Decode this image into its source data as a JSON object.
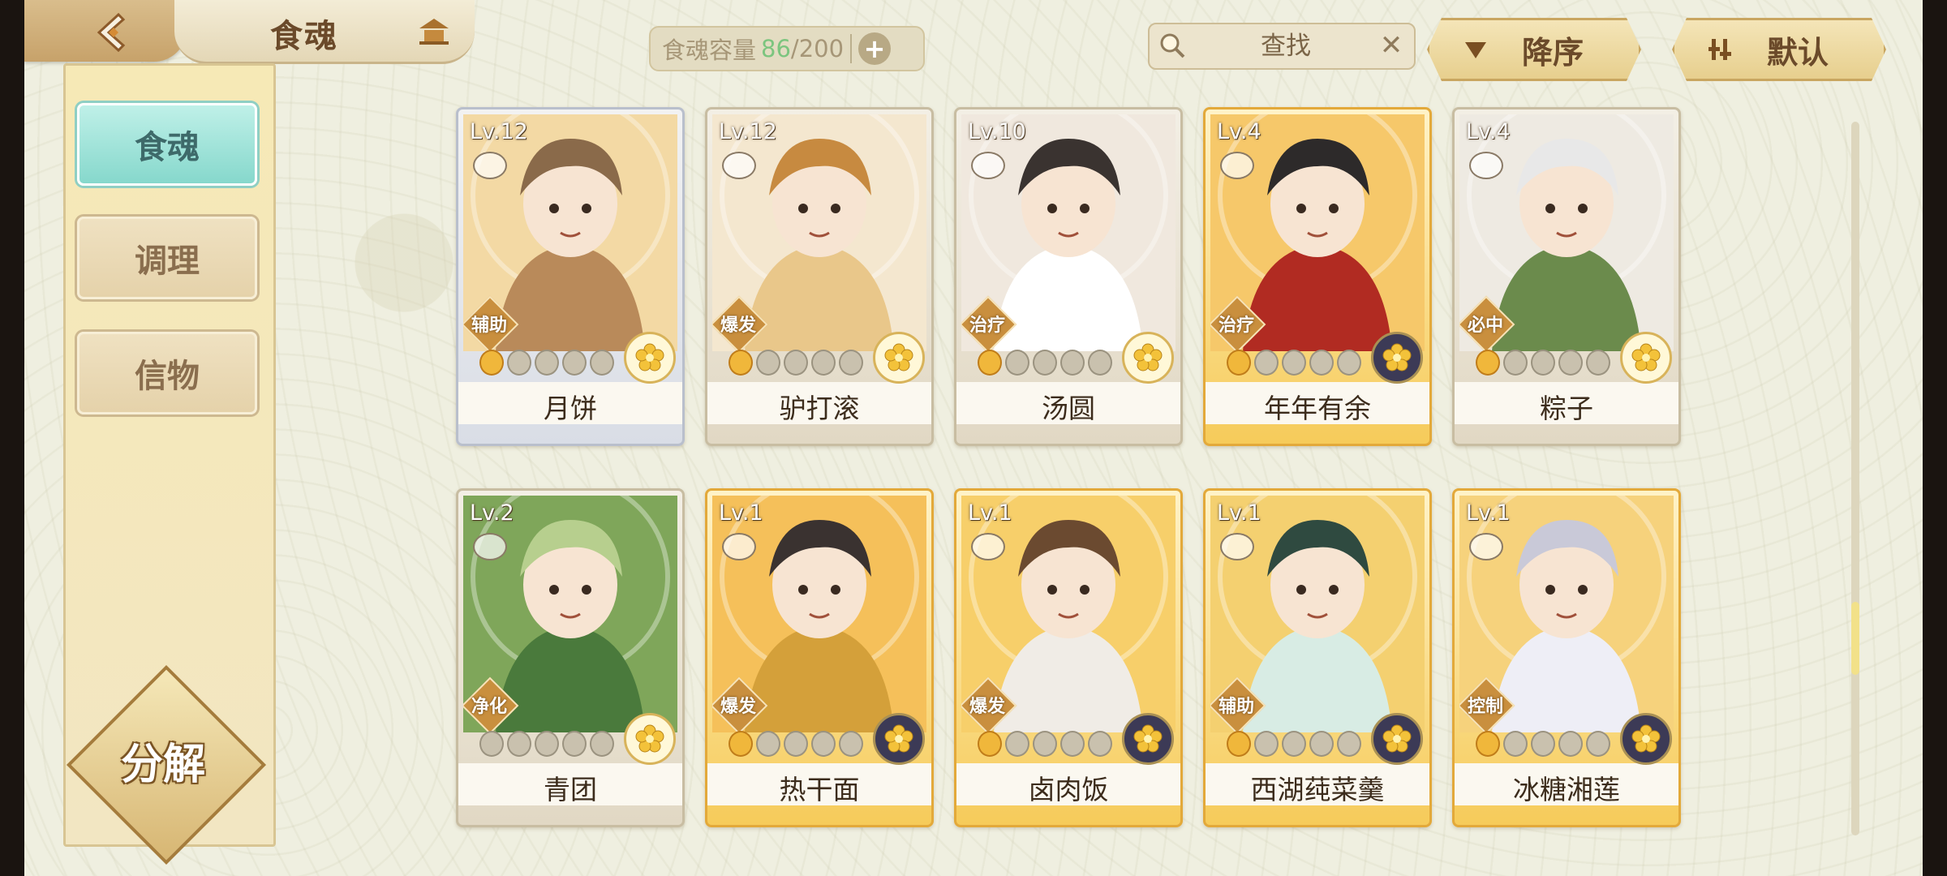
{
  "header": {
    "title": "食魂",
    "capacity_label": "食魂容量",
    "capacity_current": "86",
    "capacity_max": "/200"
  },
  "search": {
    "placeholder": "查找"
  },
  "sort": {
    "order_label": "降序",
    "default_label": "默认"
  },
  "sidebar": {
    "tabs": [
      {
        "label": "食魂",
        "active": true
      },
      {
        "label": "调理",
        "active": false
      },
      {
        "label": "信物",
        "active": false
      }
    ],
    "decompose_label": "分解"
  },
  "cards": [
    {
      "level": "Lv.12",
      "name": "月饼",
      "role": "辅助",
      "stars": 1,
      "frame": "silver",
      "rarity": "light"
    },
    {
      "level": "Lv.12",
      "name": "驴打滚",
      "role": "爆发",
      "stars": 1,
      "frame": "plain",
      "rarity": "light"
    },
    {
      "level": "Lv.10",
      "name": "汤圆",
      "role": "治疗",
      "stars": 1,
      "frame": "plain",
      "rarity": "light"
    },
    {
      "level": "Lv.4",
      "name": "年年有余",
      "role": "治疗",
      "stars": 1,
      "frame": "gold",
      "rarity": "dark"
    },
    {
      "level": "Lv.4",
      "name": "粽子",
      "role": "必中",
      "stars": 1,
      "frame": "plain",
      "rarity": "light"
    },
    {
      "level": "Lv.2",
      "name": "青团",
      "role": "净化",
      "stars": 0,
      "frame": "plain",
      "rarity": "light"
    },
    {
      "level": "Lv.1",
      "name": "热干面",
      "role": "爆发",
      "stars": 1,
      "frame": "gold",
      "rarity": "dark"
    },
    {
      "level": "Lv.1",
      "name": "卤肉饭",
      "role": "爆发",
      "stars": 1,
      "frame": "gold",
      "rarity": "dark"
    },
    {
      "level": "Lv.1",
      "name": "西湖莼菜羹",
      "role": "辅助",
      "stars": 1,
      "frame": "gold",
      "rarity": "dark"
    },
    {
      "level": "Lv.1",
      "name": "冰糖湘莲",
      "role": "控制",
      "stars": 1,
      "frame": "gold",
      "rarity": "dark"
    }
  ],
  "colors": {
    "capacity_current": "#7cc57f",
    "active_tab": "#86d8cc",
    "gold_frame": "#f6cb5a"
  },
  "portrait_palettes": [
    [
      "#f3d9a4",
      "#b98a5a",
      "#8a6a4a"
    ],
    [
      "#f4e7cf",
      "#e9c78a",
      "#c78a40"
    ],
    [
      "#f0e8de",
      "#ffffff",
      "#3a3330"
    ],
    [
      "#f6c86a",
      "#b12b22",
      "#2d2a2a"
    ],
    [
      "#eeeae2",
      "#6b8b4c",
      "#e8e8e8"
    ],
    [
      "#7fa65a",
      "#4a7a3c",
      "#b7cf8e"
    ],
    [
      "#f5c05a",
      "#d4a03a",
      "#3a3230"
    ],
    [
      "#f7cf6a",
      "#f0ece6",
      "#6b4a30"
    ],
    [
      "#f4d070",
      "#d8ece4",
      "#2f4a40"
    ],
    [
      "#f6d27c",
      "#eeeef6",
      "#c9c9d8"
    ]
  ]
}
